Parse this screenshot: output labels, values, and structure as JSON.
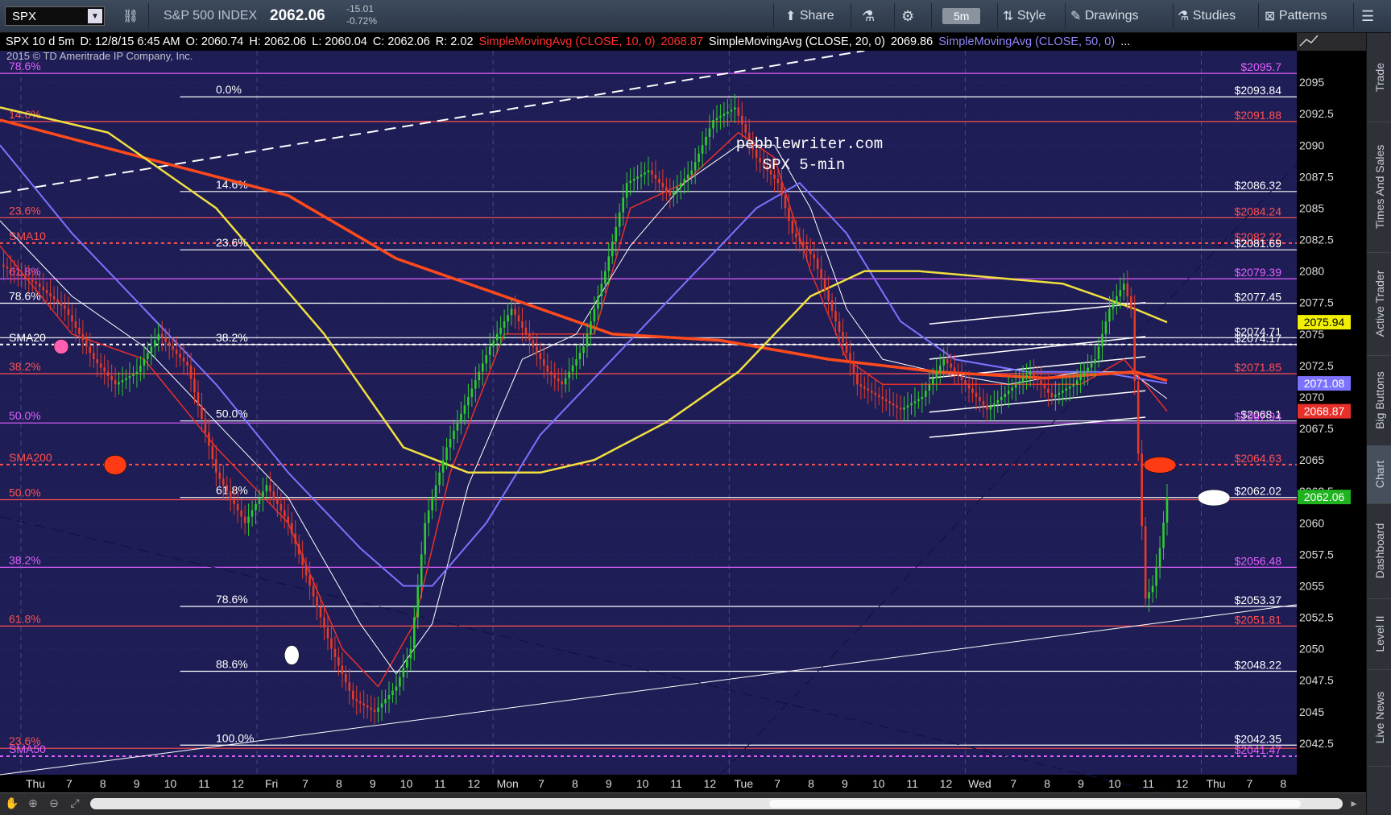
{
  "toolbar": {
    "symbol": "SPX",
    "index_name": "S&P 500 INDEX",
    "last_price": "2062.06",
    "net_change": "-15.01",
    "pct_change": "-0.72%",
    "share": "Share",
    "timeframe": "5m",
    "style": "Style",
    "drawings": "Drawings",
    "studies": "Studies",
    "patterns": "Patterns"
  },
  "infobar": {
    "symbol_period": "SPX 10 d 5m",
    "datetime": "D: 12/8/15 6:45 AM",
    "open": "O: 2060.74",
    "high": "H: 2062.06",
    "low": "L: 2060.04",
    "close": "C: 2062.06",
    "range": "R: 2.02",
    "sma10_label": "SimpleMovingAvg (CLOSE, 10, 0)",
    "sma10_value": "2068.87",
    "sma20_label": "SimpleMovingAvg (CLOSE, 20, 0)",
    "sma20_value": "2069.86",
    "sma50_label": "SimpleMovingAvg (CLOSE, 50, 0)",
    "more": "..."
  },
  "copyright": "2015 © TD Ameritrade IP Company, Inc.",
  "side_tabs": [
    "Trade",
    "Times And Sales",
    "Active Trader",
    "Big Buttons",
    "Chart",
    "Dashboard",
    "Level II",
    "Live News"
  ],
  "colors": {
    "background": "#1f1d56",
    "price_up": "#2ecc2e",
    "price_down": "#e23b2a",
    "sma10": "#e8302a",
    "sma20": "#ffffff",
    "sma50": "#7b73ff",
    "sma200": "#ff4a1c",
    "yellow_ma": "#f0e040",
    "fib_red": "#ff5050",
    "fib_magenta": "#e060ff",
    "last_price_tag": "#1fb31f"
  },
  "chart_data": {
    "type": "candlestick",
    "title": "pebblewriter.com",
    "subtitle": "SPX 5-min",
    "ylim": [
      2040.0,
      2097.5
    ],
    "y_ticks": [
      "2095",
      "2092.5",
      "2090",
      "2087.5",
      "2085",
      "2082.5",
      "2080",
      "2077.5",
      "2075",
      "2072.5",
      "2070",
      "2067.5",
      "2065",
      "2062.5",
      "2060",
      "2057.5",
      "2055",
      "2052.5",
      "2050",
      "2047.5",
      "2045",
      "2042.5"
    ],
    "x_tick_labels": [
      "Thu",
      "7",
      "8",
      "9",
      "10",
      "11",
      "12",
      "Fri",
      "7",
      "8",
      "9",
      "10",
      "11",
      "12",
      "Mon",
      "7",
      "8",
      "9",
      "10",
      "11",
      "12",
      "Tue",
      "7",
      "8",
      "9",
      "10",
      "11",
      "12",
      "Wed",
      "7",
      "8",
      "9",
      "10",
      "11",
      "12",
      "Thu",
      "7",
      "8"
    ],
    "session_dividers": [
      "Fri",
      "Mon",
      "Tue",
      "Wed",
      "Thu"
    ],
    "price_path": [
      [
        0,
        2080.5
      ],
      [
        10,
        2079
      ],
      [
        18,
        2077
      ],
      [
        26,
        2073
      ],
      [
        32,
        2071
      ],
      [
        38,
        2072
      ],
      [
        44,
        2075
      ],
      [
        52,
        2072.5
      ],
      [
        60,
        2064
      ],
      [
        68,
        2060
      ],
      [
        74,
        2063
      ],
      [
        80,
        2060
      ],
      [
        86,
        2055
      ],
      [
        92,
        2050
      ],
      [
        98,
        2046
      ],
      [
        104,
        2045
      ],
      [
        110,
        2047
      ],
      [
        114,
        2050
      ],
      [
        118,
        2060
      ],
      [
        124,
        2066
      ],
      [
        130,
        2070
      ],
      [
        136,
        2074
      ],
      [
        142,
        2077
      ],
      [
        148,
        2074
      ],
      [
        152,
        2072
      ],
      [
        156,
        2071
      ],
      [
        162,
        2074
      ],
      [
        168,
        2080
      ],
      [
        174,
        2087
      ],
      [
        180,
        2088
      ],
      [
        186,
        2086
      ],
      [
        192,
        2088
      ],
      [
        198,
        2092
      ],
      [
        204,
        2093
      ],
      [
        210,
        2089
      ],
      [
        216,
        2087
      ],
      [
        220,
        2083
      ],
      [
        226,
        2081
      ],
      [
        232,
        2076
      ],
      [
        238,
        2071
      ],
      [
        244,
        2070
      ],
      [
        250,
        2069
      ],
      [
        256,
        2070
      ],
      [
        262,
        2073
      ],
      [
        268,
        2071
      ],
      [
        274,
        2069
      ],
      [
        280,
        2070.5
      ],
      [
        286,
        2072
      ],
      [
        292,
        2070
      ],
      [
        298,
        2071
      ],
      [
        304,
        2073
      ],
      [
        308,
        2077
      ],
      [
        312,
        2079
      ],
      [
        314,
        2077
      ],
      [
        318,
        2054
      ],
      [
        320,
        2055
      ],
      [
        322,
        2058
      ],
      [
        324,
        2062.06
      ]
    ],
    "series": [
      {
        "name": "SMA10",
        "values": [
          [
            0,
            2082
          ],
          [
            20,
            2075
          ],
          [
            40,
            2073
          ],
          [
            60,
            2066
          ],
          [
            80,
            2060
          ],
          [
            95,
            2050
          ],
          [
            105,
            2047
          ],
          [
            115,
            2052
          ],
          [
            125,
            2064
          ],
          [
            140,
            2075
          ],
          [
            150,
            2075
          ],
          [
            165,
            2075
          ],
          [
            175,
            2085
          ],
          [
            190,
            2087
          ],
          [
            205,
            2091
          ],
          [
            215,
            2089
          ],
          [
            225,
            2080
          ],
          [
            235,
            2073
          ],
          [
            245,
            2071
          ],
          [
            260,
            2071
          ],
          [
            280,
            2071
          ],
          [
            300,
            2071
          ],
          [
            312,
            2073
          ],
          [
            318,
            2071
          ],
          [
            324,
            2068.87
          ]
        ]
      },
      {
        "name": "SMA20",
        "values": [
          [
            0,
            2084
          ],
          [
            20,
            2078
          ],
          [
            40,
            2074
          ],
          [
            60,
            2068
          ],
          [
            80,
            2062
          ],
          [
            100,
            2052
          ],
          [
            110,
            2048
          ],
          [
            120,
            2052
          ],
          [
            130,
            2063
          ],
          [
            145,
            2073
          ],
          [
            160,
            2075
          ],
          [
            175,
            2082
          ],
          [
            190,
            2087
          ],
          [
            205,
            2090
          ],
          [
            215,
            2090
          ],
          [
            225,
            2085
          ],
          [
            235,
            2077
          ],
          [
            245,
            2073
          ],
          [
            260,
            2072
          ],
          [
            280,
            2071
          ],
          [
            300,
            2072
          ],
          [
            314,
            2072
          ],
          [
            324,
            2069.86
          ]
        ]
      },
      {
        "name": "SMA50",
        "values": [
          [
            0,
            2090
          ],
          [
            20,
            2083
          ],
          [
            40,
            2077
          ],
          [
            60,
            2071
          ],
          [
            80,
            2064
          ],
          [
            100,
            2058
          ],
          [
            112,
            2055
          ],
          [
            120,
            2055
          ],
          [
            135,
            2060
          ],
          [
            150,
            2067
          ],
          [
            170,
            2073
          ],
          [
            190,
            2079
          ],
          [
            210,
            2085
          ],
          [
            222,
            2087
          ],
          [
            235,
            2083
          ],
          [
            250,
            2076
          ],
          [
            265,
            2073
          ],
          [
            285,
            2072
          ],
          [
            305,
            2072
          ],
          [
            324,
            2071.08
          ]
        ]
      },
      {
        "name": "SMA200",
        "values": [
          [
            0,
            2092
          ],
          [
            40,
            2089
          ],
          [
            80,
            2086
          ],
          [
            110,
            2081
          ],
          [
            140,
            2078
          ],
          [
            170,
            2075
          ],
          [
            200,
            2074.5
          ],
          [
            230,
            2073
          ],
          [
            260,
            2072
          ],
          [
            290,
            2071.5
          ],
          [
            315,
            2072
          ],
          [
            324,
            2071.3
          ]
        ]
      },
      {
        "name": "MA-yellow",
        "values": [
          [
            0,
            2093
          ],
          [
            30,
            2091
          ],
          [
            60,
            2085
          ],
          [
            90,
            2075
          ],
          [
            112,
            2066
          ],
          [
            130,
            2064
          ],
          [
            150,
            2064
          ],
          [
            165,
            2065
          ],
          [
            185,
            2068
          ],
          [
            205,
            2072
          ],
          [
            225,
            2078
          ],
          [
            240,
            2080
          ],
          [
            255,
            2080
          ],
          [
            275,
            2079.5
          ],
          [
            295,
            2079
          ],
          [
            315,
            2077
          ],
          [
            324,
            2075.94
          ]
        ]
      }
    ],
    "price_tags": [
      {
        "value": 2075.94,
        "label": "2075.94",
        "color": "#f0f000",
        "text": "#000"
      },
      {
        "value": 2071.08,
        "label": "2071.08",
        "color": "#7b73ff",
        "text": "#fff"
      },
      {
        "value": 2068.87,
        "label": "2068.87",
        "color": "#e8302a",
        "text": "#fff"
      },
      {
        "value": 2062.06,
        "label": "2062.06",
        "color": "#1fb31f",
        "text": "#fff"
      }
    ],
    "horizontal_levels": [
      {
        "value": 2095.7,
        "color": "#e060ff",
        "dash": false,
        "right": "$2095.7",
        "left": "78.6%",
        "lx": 0
      },
      {
        "value": 2093.84,
        "color": "#ffffff",
        "dash": false,
        "right": "$2093.84",
        "left": "0.0%",
        "lx": 50
      },
      {
        "value": 2091.88,
        "color": "#ff5050",
        "dash": false,
        "right": "$2091.88",
        "left": "14.6%",
        "lx": 0
      },
      {
        "value": 2086.32,
        "color": "#ffffff",
        "dash": false,
        "right": "$2086.32",
        "left": "14.6%",
        "lx": 50
      },
      {
        "value": 2084.24,
        "color": "#ff5050",
        "dash": false,
        "right": "$2084.24",
        "left": "23.6%",
        "lx": 0
      },
      {
        "value": 2082.22,
        "color": "#ff5050",
        "dash": true,
        "right": "$2082.22",
        "left": "SMA10",
        "lx": 0
      },
      {
        "value": 2081.69,
        "color": "#ffffff",
        "dash": false,
        "right": "$2081.69",
        "left": "23.6%",
        "lx": 50
      },
      {
        "value": 2079.39,
        "color": "#e060ff",
        "dash": false,
        "right": "$2079.39",
        "left": "61.8%",
        "lx": 0
      },
      {
        "value": 2077.45,
        "color": "#ffffff",
        "dash": false,
        "right": "$2077.45",
        "left": "78.6%",
        "lx": 0
      },
      {
        "value": 2074.71,
        "color": "#ffffff",
        "dash": false,
        "right": "$2074.71",
        "left": "",
        "lx": 0
      },
      {
        "value": 2074.17,
        "color": "#ffffff",
        "dash": true,
        "right": "$2074.17",
        "left": "SMA20",
        "lx": 0
      },
      {
        "value": 2074.17,
        "color": "#ffffff",
        "dash": false,
        "right": "",
        "left": "38.2%",
        "lx": 50
      },
      {
        "value": 2071.85,
        "color": "#ff5050",
        "dash": false,
        "right": "$2071.85",
        "left": "38.2%",
        "lx": 0
      },
      {
        "value": 2068.1,
        "color": "#ffffff",
        "dash": false,
        "right": "$2068.1",
        "left": "50.0%",
        "lx": 50
      },
      {
        "value": 2067.94,
        "color": "#e060ff",
        "dash": false,
        "right": "$2067.94",
        "left": "50.0%",
        "lx": 0
      },
      {
        "value": 2064.63,
        "color": "#ff5050",
        "dash": true,
        "right": "$2064.63",
        "left": "SMA200",
        "lx": 0
      },
      {
        "value": 2062.02,
        "color": "#ffffff",
        "dash": false,
        "right": "$2062.02",
        "left": "61.8%",
        "lx": 50
      },
      {
        "value": 2061.84,
        "color": "#ff5050",
        "dash": false,
        "right": "",
        "left": "50.0%",
        "lx": 0
      },
      {
        "value": 2056.48,
        "color": "#e060ff",
        "dash": false,
        "right": "$2056.48",
        "left": "38.2%",
        "lx": 0
      },
      {
        "value": 2053.37,
        "color": "#ffffff",
        "dash": false,
        "right": "$2053.37",
        "left": "78.6%",
        "lx": 50
      },
      {
        "value": 2051.81,
        "color": "#ff5050",
        "dash": false,
        "right": "$2051.81",
        "left": "61.8%",
        "lx": 0
      },
      {
        "value": 2048.22,
        "color": "#ffffff",
        "dash": false,
        "right": "$2048.22",
        "left": "88.6%",
        "lx": 50
      },
      {
        "value": 2042.35,
        "color": "#ffffff",
        "dash": false,
        "right": "$2042.35",
        "left": "100.0%",
        "lx": 50
      },
      {
        "value": 2042.1,
        "color": "#ff5050",
        "dash": false,
        "right": "",
        "left": "23.6%",
        "lx": 0
      },
      {
        "value": 2041.47,
        "color": "#e060ff",
        "dash": true,
        "right": "$2041.47",
        "left": "SMA50",
        "lx": 0
      }
    ],
    "trendlines": [
      {
        "from": [
          0,
          2086.2
        ],
        "to": [
          240,
          2097.5
        ],
        "color": "#ffffff",
        "dash": true,
        "width": 2
      },
      {
        "from": [
          0,
          2040.0
        ],
        "to": [
          360,
          2053.5
        ],
        "color": "#ffffff",
        "dash": false,
        "width": 1
      },
      {
        "from": [
          0,
          2060.5
        ],
        "to": [
          360,
          2036.0
        ],
        "color": "#101040",
        "dash": true,
        "width": 1
      },
      {
        "from": [
          200,
          2040.0
        ],
        "to": [
          360,
          2088.5
        ],
        "color": "#101040",
        "dash": true,
        "width": 1
      },
      {
        "from": [
          258,
          2075.8
        ],
        "to": [
          318,
          2077.5
        ],
        "color": "#ffffff",
        "dash": false,
        "width": 1.5
      },
      {
        "from": [
          258,
          2073.0
        ],
        "to": [
          318,
          2074.8
        ],
        "color": "#ffffff",
        "dash": false,
        "width": 1.5
      },
      {
        "from": [
          258,
          2071.5
        ],
        "to": [
          318,
          2073.2
        ],
        "color": "#ffffff",
        "dash": false,
        "width": 1.5
      },
      {
        "from": [
          258,
          2068.8
        ],
        "to": [
          318,
          2070.5
        ],
        "color": "#ffffff",
        "dash": false,
        "width": 1.5
      },
      {
        "from": [
          258,
          2066.8
        ],
        "to": [
          318,
          2068.4
        ],
        "color": "#ffffff",
        "dash": false,
        "width": 1.5
      }
    ],
    "markers": [
      {
        "x": 17,
        "y": 2074.0,
        "rx": 9,
        "ry": 9,
        "color": "#ff5fb0"
      },
      {
        "x": 32,
        "y": 2064.6,
        "rx": 14,
        "ry": 12,
        "color": "#ff3b14"
      },
      {
        "x": 81,
        "y": 2049.5,
        "rx": 9,
        "ry": 12,
        "color": "#ffffff"
      },
      {
        "x": 322,
        "y": 2064.6,
        "rx": 20,
        "ry": 10,
        "color": "#ff3b14"
      },
      {
        "x": 337,
        "y": 2062.0,
        "rx": 20,
        "ry": 10,
        "color": "#ffffff"
      }
    ]
  }
}
